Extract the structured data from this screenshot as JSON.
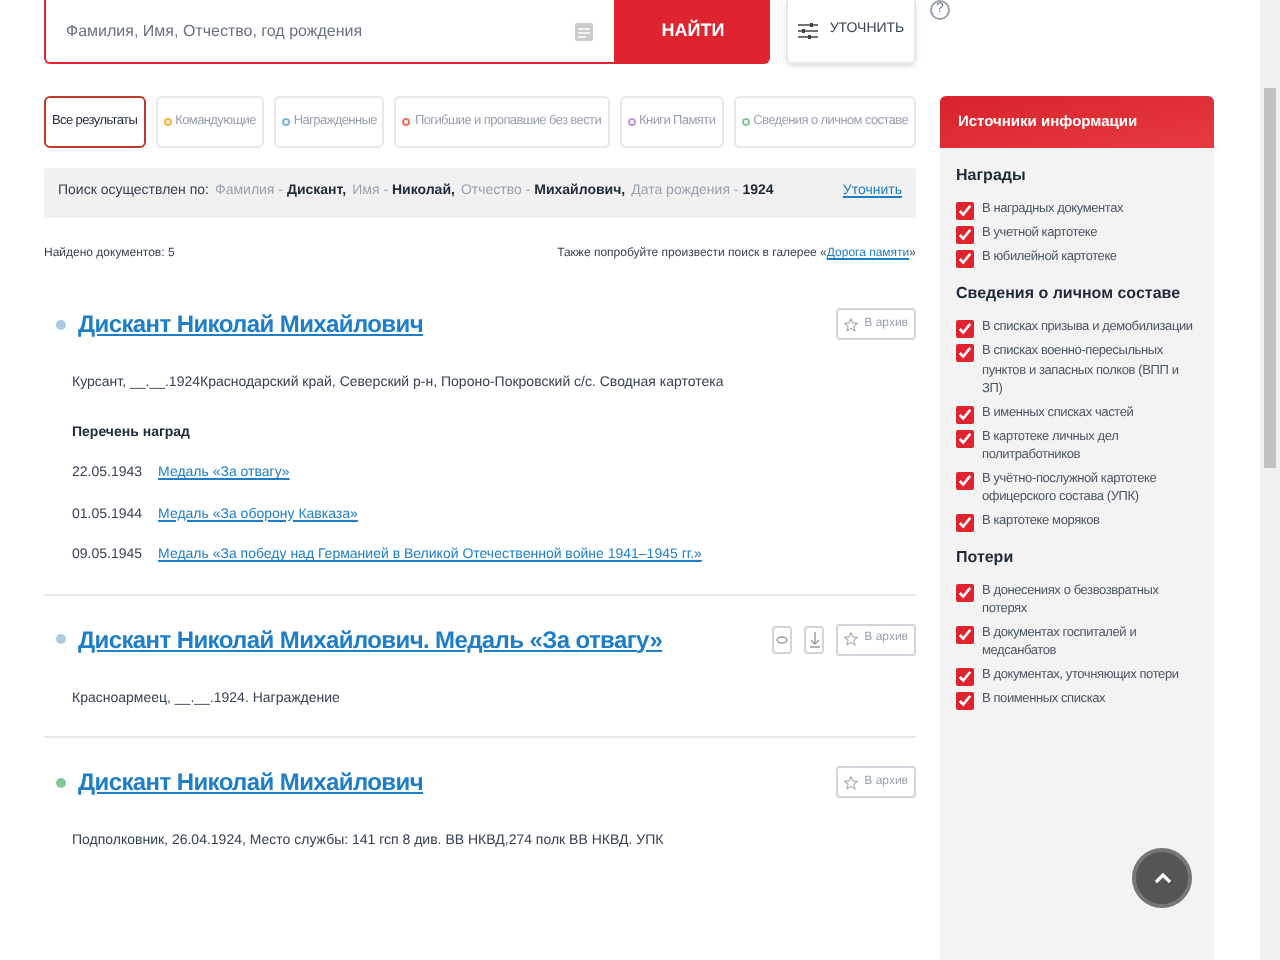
{
  "search": {
    "placeholder": "Фамилия, Имя, Отчество, год рождения",
    "submit": "НАЙТИ",
    "refine": "УТОЧНИТЬ",
    "help": "?"
  },
  "filters": [
    {
      "label": "Все результаты",
      "selected": true
    },
    {
      "label": "Командующие",
      "selected": false,
      "color": "#f5b041"
    },
    {
      "label": "Награжденные",
      "selected": false,
      "color": "#7fb3d5"
    },
    {
      "label": "Погибшие и пропавшие без вести",
      "selected": false,
      "color": "#ec7063"
    },
    {
      "label": "Книги Памяти",
      "selected": false,
      "color": "#c39bd3"
    },
    {
      "label": "Сведения о личном составе",
      "selected": false,
      "color": "#82c99a"
    }
  ],
  "query": {
    "intro": "Поиск осуществлен по:",
    "criteria": [
      {
        "name": "Фамилия -",
        "value": "Дискант,"
      },
      {
        "name": "Имя -",
        "value": "Николай,"
      },
      {
        "name": "Отчество -",
        "value": "Михайлович,"
      },
      {
        "name": "Дата рождения -",
        "value": "1924"
      }
    ],
    "refine_link": "Уточнить"
  },
  "found": "Найдено документов: 5",
  "gallery_hint": {
    "text": "Также попробуйте произвести поиск в галерее «",
    "link": "Дорога памяти",
    "tail": "»"
  },
  "results": [
    {
      "title": "Дискант Николай Михайлович",
      "color": "#a9cce3",
      "description": "Курсант, __.__.1924Краснодарский край, Северский р-н, Пороно-Покровский с/с. Сводная картотека",
      "archive": "В архив",
      "awards_title": "Перечень наград",
      "awards": [
        {
          "date": "22.05.1943",
          "name": "Медаль «За отвагу»"
        },
        {
          "date": "01.05.1944",
          "name": "Медаль «За оборону Кавказа»"
        },
        {
          "date": "09.05.1945",
          "name": "Медаль «За победу над Германией в Великой Отечественной войне 1941–1945 гг.»"
        }
      ]
    },
    {
      "title": "Дискант Николай Михайлович. Медаль «За отвагу»",
      "color": "#a9cce3",
      "description": "Красноармеец, __.__.1924. Награждение",
      "view": true,
      "download": true,
      "archive": "В архив"
    },
    {
      "title": "Дискант Николай Михайлович",
      "color": "#82c99a",
      "description": "Подполковник, 26.04.1924, Место службы: 141 гсп 8 див. ВВ НКВД,274 полк ВВ НКВД. УПК",
      "archive": "В архив"
    }
  ],
  "sources": {
    "title": "Источники информации",
    "sections": [
      {
        "title": "Награды",
        "items": [
          {
            "label": "В наградных документах",
            "checked": true
          },
          {
            "label": "В учетной картотеке",
            "checked": true
          },
          {
            "label": "В юбилейной картотеке",
            "checked": true
          }
        ]
      },
      {
        "title": "Сведения о личном составе",
        "items": [
          {
            "label": "В списках призыва и демобилизации",
            "checked": true
          },
          {
            "label": "В списках военно-пересыльных пунктов и запасных полков (ВПП и ЗП)",
            "checked": true
          },
          {
            "label": "В именных списках частей",
            "checked": true
          },
          {
            "label": "В картотеке личных дел политработников",
            "checked": true
          },
          {
            "label": "В учётно-послужной картотеке офицерского состава (УПК)",
            "checked": true
          },
          {
            "label": "В картотеке моряков",
            "checked": true
          }
        ]
      },
      {
        "title": "Потери",
        "items": [
          {
            "label": "В донесениях о безвозвратных потерях",
            "checked": true
          },
          {
            "label": "В документах госпиталей и медсанбатов",
            "checked": true
          },
          {
            "label": "В документах, уточняющих потери",
            "checked": true
          },
          {
            "label": "В поименных списках",
            "checked": true
          }
        ]
      }
    ]
  }
}
